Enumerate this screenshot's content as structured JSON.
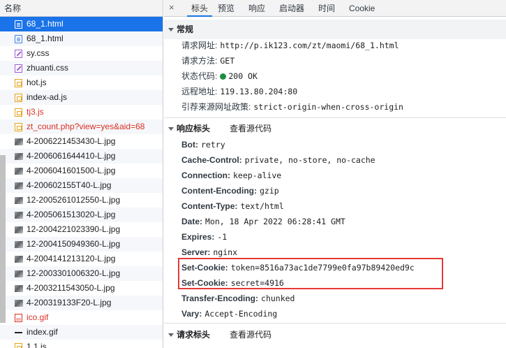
{
  "file_panel": {
    "header": "名称",
    "files": [
      {
        "name": "68_1.html",
        "icon": "document-icon",
        "type": "doc",
        "state": "selected"
      },
      {
        "name": "68_1.html",
        "icon": "document-icon",
        "type": "doc",
        "state": ""
      },
      {
        "name": "sy.css",
        "icon": "stylesheet-icon",
        "type": "css",
        "state": ""
      },
      {
        "name": "zhuanti.css",
        "icon": "stylesheet-icon",
        "type": "css",
        "state": ""
      },
      {
        "name": "hot.js",
        "icon": "script-icon",
        "type": "js",
        "state": ""
      },
      {
        "name": "index-ad.js",
        "icon": "script-icon",
        "type": "js",
        "state": ""
      },
      {
        "name": "tj3.js",
        "icon": "script-icon",
        "type": "js",
        "state": "error"
      },
      {
        "name": "zt_count.php?view=yes&aid=68",
        "icon": "document-icon",
        "type": "js",
        "state": "error"
      },
      {
        "name": "4-2006221453430-L.jpg",
        "icon": "image-icon",
        "type": "img",
        "state": ""
      },
      {
        "name": "4-2006061644410-L.jpg",
        "icon": "image-icon",
        "type": "img",
        "state": ""
      },
      {
        "name": "4-2006041601500-L.jpg",
        "icon": "image-icon",
        "type": "img",
        "state": ""
      },
      {
        "name": "4-200602155T40-L.jpg",
        "icon": "image-icon",
        "type": "img",
        "state": ""
      },
      {
        "name": "12-2005261012550-L.jpg",
        "icon": "image-icon",
        "type": "img",
        "state": ""
      },
      {
        "name": "4-2005061513020-L.jpg",
        "icon": "image-icon",
        "type": "img",
        "state": ""
      },
      {
        "name": "12-2004221023390-L.jpg",
        "icon": "image-icon",
        "type": "img",
        "state": ""
      },
      {
        "name": "12-2004150949360-L.jpg",
        "icon": "image-icon",
        "type": "img",
        "state": ""
      },
      {
        "name": "4-2004141213120-L.jpg",
        "icon": "image-icon",
        "type": "img",
        "state": ""
      },
      {
        "name": "12-2003301006320-L.jpg",
        "icon": "image-icon",
        "type": "img",
        "state": ""
      },
      {
        "name": "4-2003211543050-L.jpg",
        "icon": "image-icon",
        "type": "img",
        "state": ""
      },
      {
        "name": "4-200319133F20-L.jpg",
        "icon": "image-icon",
        "type": "img",
        "state": ""
      },
      {
        "name": "ico.gif",
        "icon": "image-icon",
        "type": "gif",
        "state": "error"
      },
      {
        "name": "index.gif",
        "icon": "image-icon",
        "type": "gifplain",
        "state": ""
      },
      {
        "name": "1.1.js",
        "icon": "script-icon",
        "type": "js",
        "state": ""
      }
    ]
  },
  "tabs": {
    "close": "×",
    "headers": "标头",
    "preview": "预览",
    "response": "响应",
    "initiator": "启动器",
    "timing": "时间",
    "cookie": "Cookie"
  },
  "general": {
    "title": "常规",
    "rows": [
      {
        "key": "请求网址:",
        "value": "http://p.ik123.com/zt/maomi/68_1.html"
      },
      {
        "key": "请求方法:",
        "value": "GET"
      },
      {
        "key": "状态代码:",
        "value": "200 OK"
      },
      {
        "key": "远程地址:",
        "value": "119.13.80.204:80"
      },
      {
        "key": "引荐来源网址政策:",
        "value": "strict-origin-when-cross-origin"
      }
    ]
  },
  "response_headers": {
    "title": "响应标头",
    "view_source": "查看源代码",
    "rows": [
      {
        "key": "Bot:",
        "value": "retry"
      },
      {
        "key": "Cache-Control:",
        "value": "private, no-store, no-cache"
      },
      {
        "key": "Connection:",
        "value": "keep-alive"
      },
      {
        "key": "Content-Encoding:",
        "value": "gzip"
      },
      {
        "key": "Content-Type:",
        "value": "text/html"
      },
      {
        "key": "Date:",
        "value": "Mon, 18 Apr 2022 06:28:41 GMT"
      },
      {
        "key": "Expires:",
        "value": "-1"
      },
      {
        "key": "Server:",
        "value": "nginx"
      },
      {
        "key": "Set-Cookie:",
        "value": "token=8516a73ac1de7799e0fa97b89420ed9c"
      },
      {
        "key": "Set-Cookie:",
        "value": "secret=4916"
      },
      {
        "key": "Transfer-Encoding:",
        "value": "chunked"
      },
      {
        "key": "Vary:",
        "value": "Accept-Encoding"
      }
    ]
  },
  "request_headers": {
    "title": "请求标头",
    "view_source": "查看源代码"
  },
  "colors": {
    "selected_row": "#1a73e8",
    "error_text": "#d93025",
    "status_ok": "#1e8e3e",
    "highlight_box": "#e53935"
  }
}
